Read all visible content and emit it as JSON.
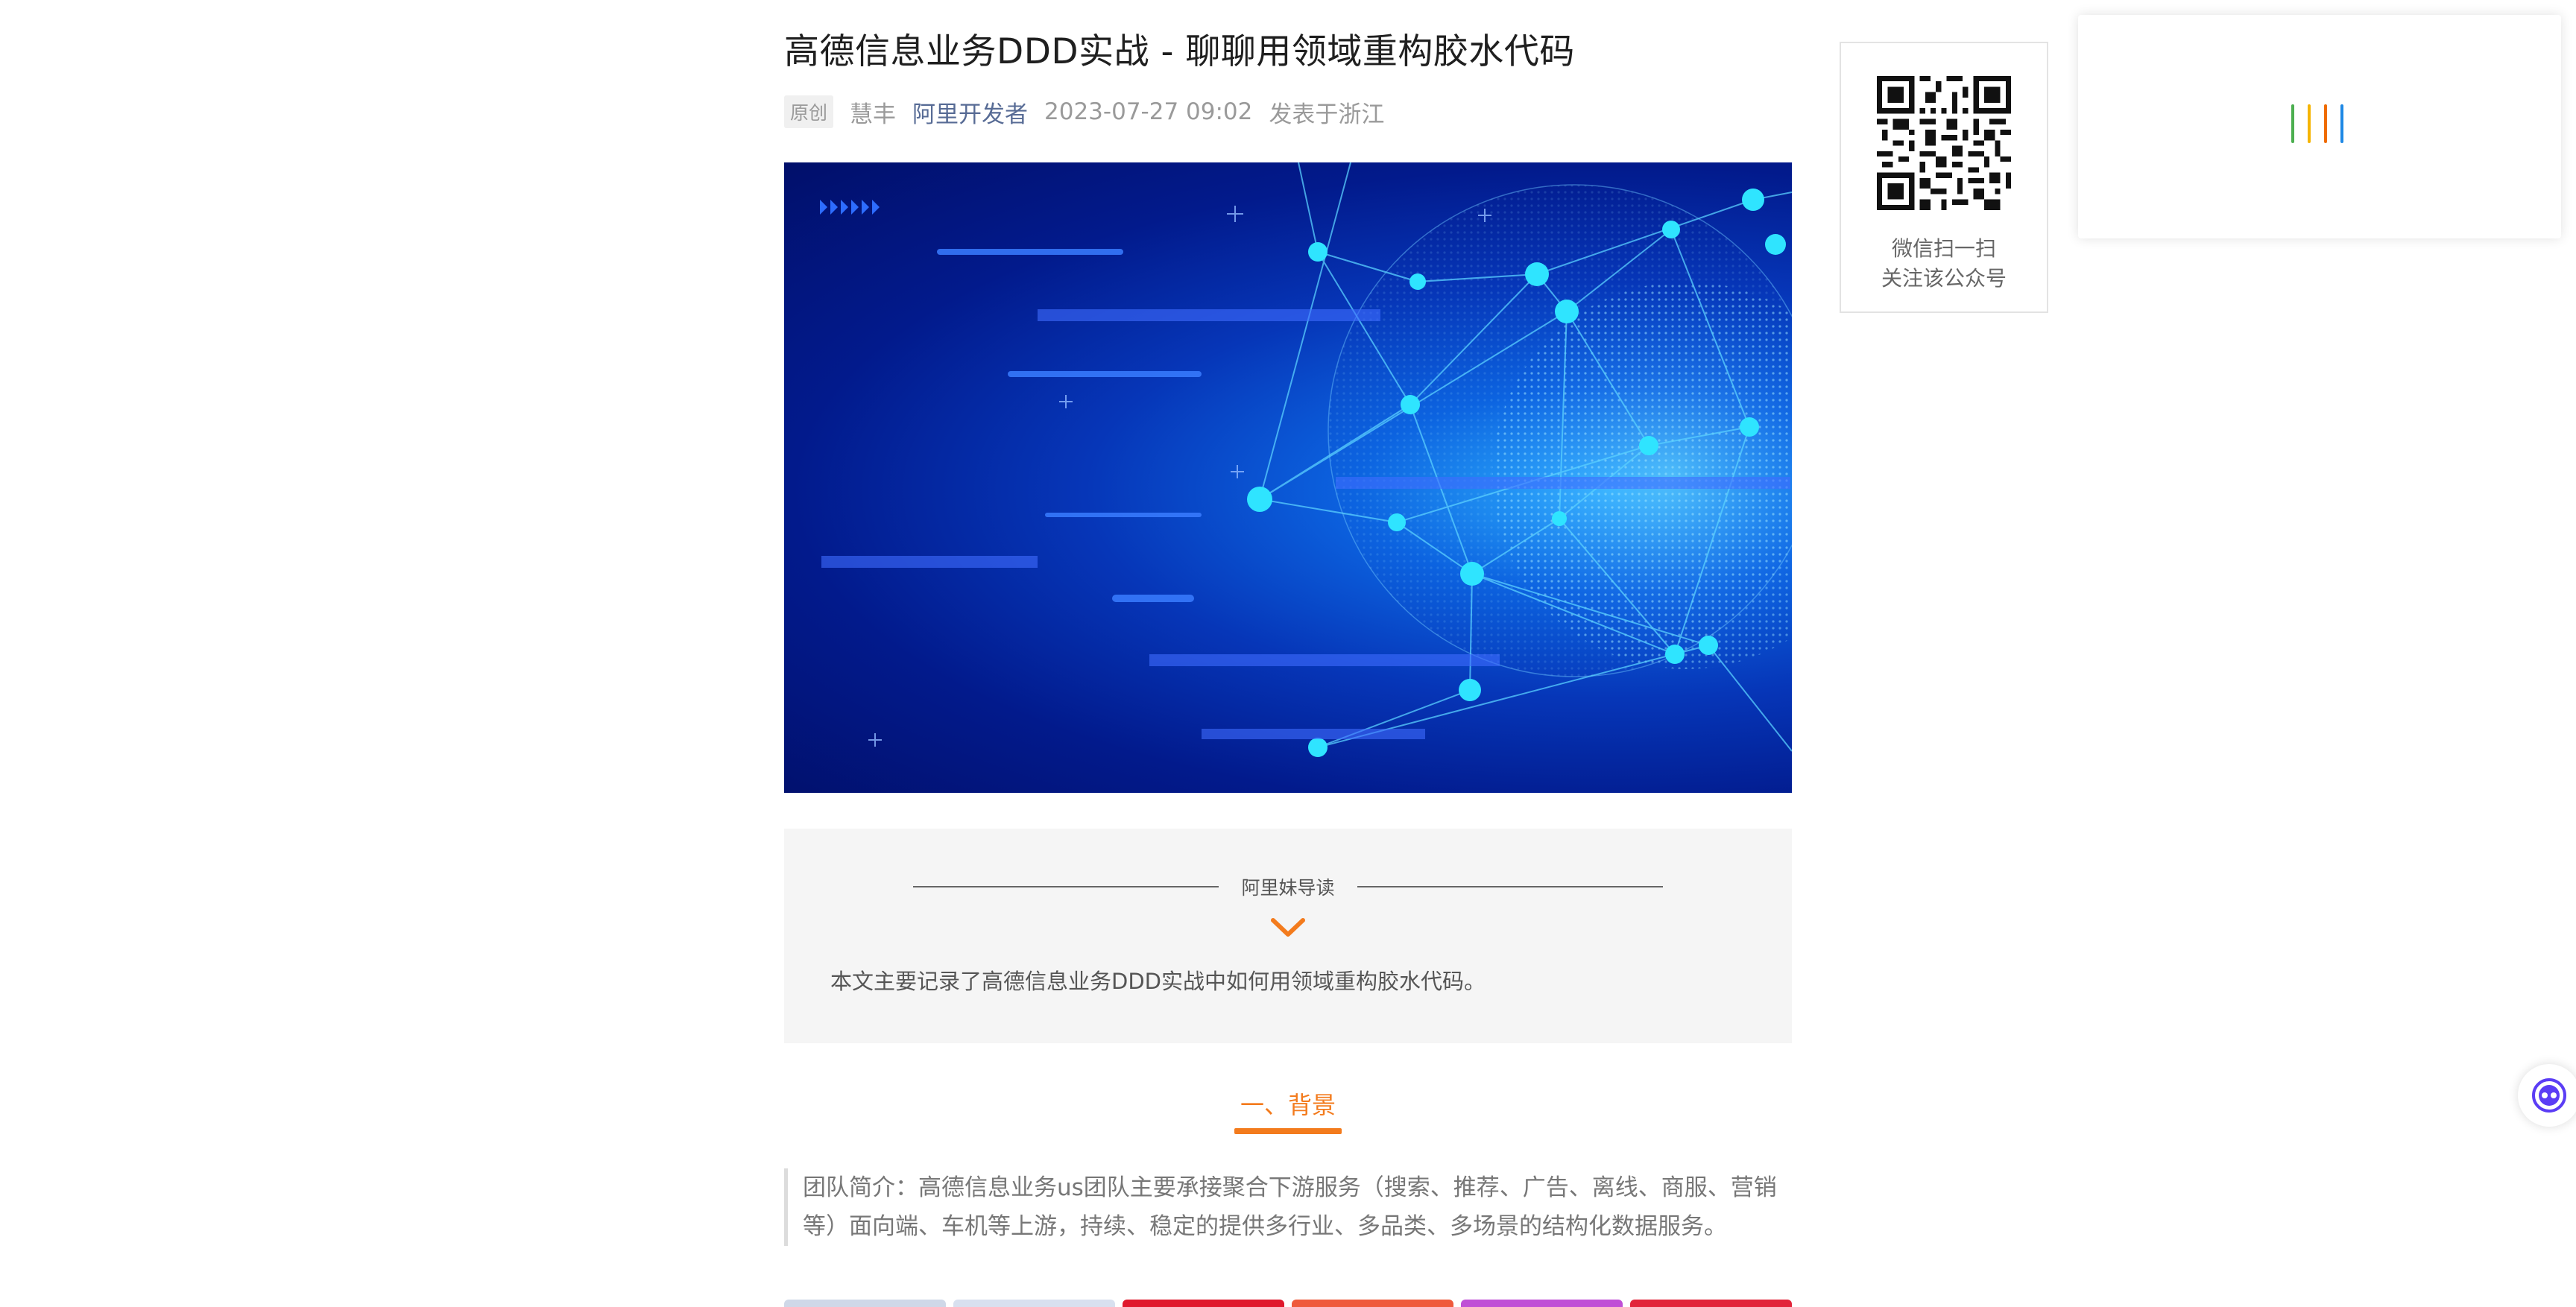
{
  "article": {
    "title": "高德信息业务DDD实战 - 聊聊用领域重构胶水代码",
    "meta": {
      "badge": "原创",
      "author": "慧丰",
      "account": "阿里开发者",
      "datetime": "2023-07-27 09:02",
      "location": "发表于浙江"
    },
    "guide": {
      "title": "阿里妹导读",
      "text": "本文主要记录了高德信息业务DDD实战中如何用领域重构胶水代码。"
    },
    "section_heading": "一、背景",
    "intro": "团队简介：高德信息业务us团队主要承接聚合下游服务（搜索、推荐、广告、离线、商服、营销等）面向端、车机等上游，持续、稳定的提供多行业、多品类、多场景的结构化数据服务。"
  },
  "qr_card": {
    "line1": "微信扫一扫",
    "line2": "关注该公众号"
  },
  "colors": {
    "accent": "#f37b1d",
    "account_link": "#576b95",
    "loading_bars": [
      "#4caf50",
      "#f5b400",
      "#ef6c00",
      "#1e88e5"
    ],
    "strip": [
      "#cfd8e8",
      "#d8e0ef",
      "#e0192d",
      "#ef5a3c",
      "#c04fd6",
      "#e2243a"
    ]
  },
  "icons": {
    "chevron": "chevron-down-icon",
    "assistant": "assistant-bot-icon",
    "qr": "qr-code-icon",
    "loading": "loading-bars-icon"
  }
}
